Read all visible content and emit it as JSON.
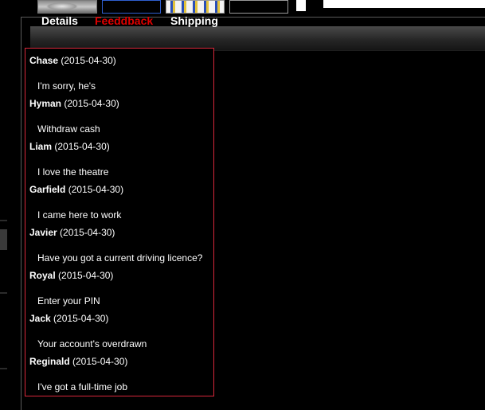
{
  "tabs": [
    {
      "label": "Details"
    },
    {
      "label": "Feeddback"
    },
    {
      "label": "Shipping"
    }
  ],
  "active_tab": "Feeddback",
  "colors": {
    "active_tab": "#e00000",
    "list_border": "#d8283a",
    "background": "#000000",
    "text": "#ffffff"
  },
  "feedback": [
    {
      "name": "Chase",
      "date": "(2015-04-30)",
      "message": "I'm sorry, he's"
    },
    {
      "name": "Hyman",
      "date": "(2015-04-30)",
      "message": "Withdraw cash"
    },
    {
      "name": "Liam",
      "date": "(2015-04-30)",
      "message": "I love the theatre"
    },
    {
      "name": "Garfield",
      "date": "(2015-04-30)",
      "message": "I came here to work"
    },
    {
      "name": "Javier",
      "date": "(2015-04-30)",
      "message": "Have you got a current driving licence?"
    },
    {
      "name": "Royal",
      "date": "(2015-04-30)",
      "message": "Enter your PIN"
    },
    {
      "name": "Jack",
      "date": "(2015-04-30)",
      "message": "Your account's overdrawn"
    },
    {
      "name": "Reginald",
      "date": "(2015-04-30)",
      "message": "I've got a full-time job"
    }
  ]
}
